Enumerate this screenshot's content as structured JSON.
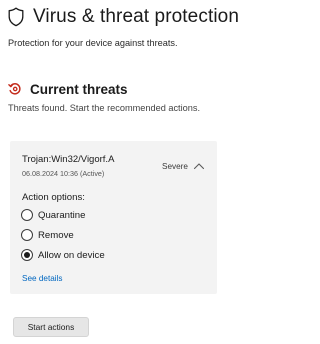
{
  "header": {
    "title": "Virus & threat protection",
    "subtitle": "Protection for your device against threats.",
    "icon": "shield-icon"
  },
  "current_threats": {
    "title": "Current threats",
    "description": "Threats found. Start the recommended actions.",
    "icon": "threat-scan-icon",
    "accent_color": "#c42b1c"
  },
  "threat": {
    "name": "Trojan:Win32/Vigorf.A",
    "date": "06.08.2024 10:36 (Active)",
    "severity": "Severe",
    "expanded": true,
    "action_options_label": "Action options:",
    "options": [
      {
        "label": "Quarantine",
        "selected": false
      },
      {
        "label": "Remove",
        "selected": false
      },
      {
        "label": "Allow on device",
        "selected": true
      }
    ],
    "see_details": "See details"
  },
  "actions": {
    "start_label": "Start actions"
  },
  "colors": {
    "link": "#0067c0",
    "card_bg": "#f3f3f3",
    "button_bg": "#e6e6e6"
  }
}
